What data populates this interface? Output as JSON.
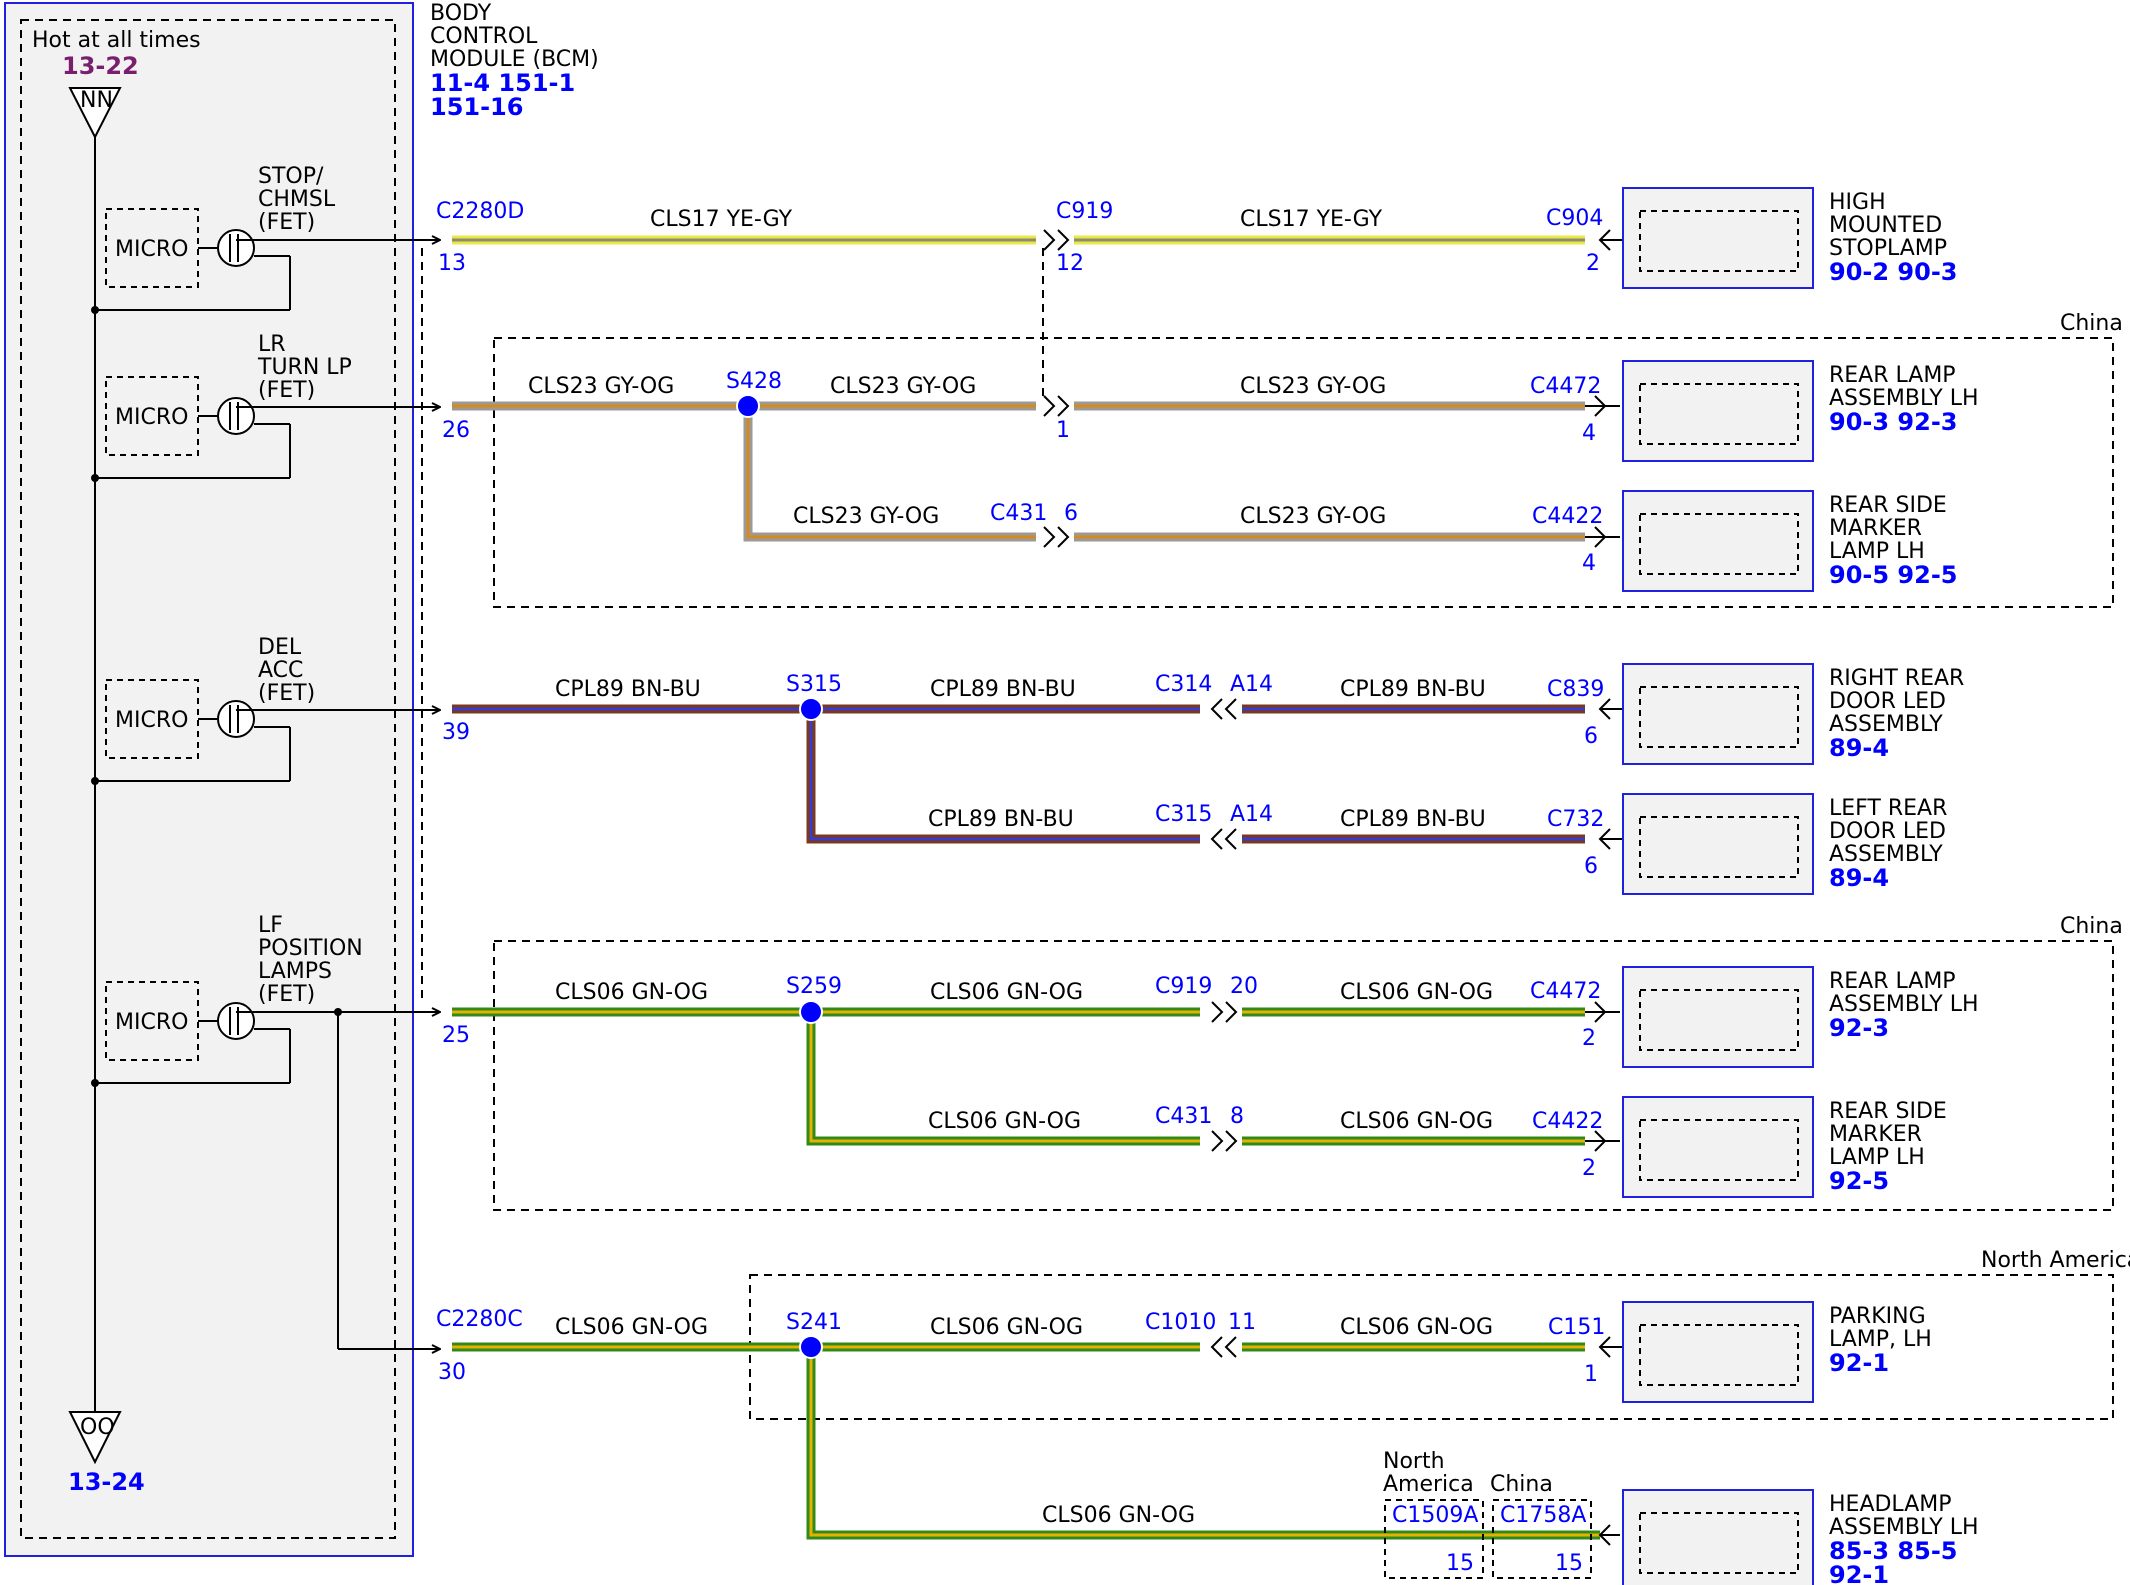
{
  "bcm": {
    "lines": [
      "BODY",
      "CONTROL",
      "MODULE (BCM)"
    ],
    "refs": [
      "11-4  151-1",
      "151-16"
    ],
    "hot_label": "Hot at all times",
    "top_ref": "13-22",
    "top_node": "NN",
    "bottom_ref": "13-24",
    "bottom_node": "OO",
    "micro": "MICRO",
    "outputs": [
      {
        "lines": [
          "STOP/",
          "CHMSL",
          "(FET)"
        ]
      },
      {
        "lines": [
          "LR",
          "TURN LP",
          "(FET)"
        ]
      },
      {
        "lines": [
          "DEL",
          "ACC",
          "(FET)"
        ]
      },
      {
        "lines": [
          "LF",
          "POSITION",
          "LAMPS",
          "(FET)"
        ]
      }
    ]
  },
  "regions": [
    "China",
    "China",
    "North America"
  ],
  "circuits": [
    "CLS17   YE-GY",
    "CLS23   GY-OG",
    "CPL89   BN-BU",
    "CLS06   GN-OG"
  ],
  "colors": {
    "ye_gy": [
      "#e8e84a",
      "#8c8c6e"
    ],
    "gy_og": [
      "#9a9a9a",
      "#d68a1e"
    ],
    "bn_bu": [
      "#7a3a1a",
      "#3a3ad0"
    ],
    "gn_og": [
      "#2f8a1a",
      "#e8b000"
    ]
  },
  "connectors": {
    "c2280d": "C2280D",
    "c2280d_pin13": "13",
    "c2280d_pin26": "26",
    "c2280d_pin39": "39",
    "c2280d_pin25": "25",
    "c2280c": "C2280C",
    "c2280c_pin30": "30",
    "c919": "C919",
    "c919_pin12": "12",
    "c919_pin1": "1",
    "c904": "C904",
    "c904_pin": "2",
    "s428": "S428",
    "s315": "S315",
    "s259": "S259",
    "s241": "S241",
    "c4472_a": "C4472",
    "c4472_a_pin": "4",
    "c431_6": "C431",
    "c431_6_pin": "6",
    "c4422_a": "C4422",
    "c4422_a_pin": "4",
    "c314": "C314",
    "c314_pin": "A14",
    "c839": "C839",
    "c839_pin": "6",
    "c315": "C315",
    "c315_pin": "A14",
    "c732": "C732",
    "c732_pin": "6",
    "c919_20": "C919",
    "c919_20_pin": "20",
    "c4472_b": "C4472",
    "c4472_b_pin": "2",
    "c431_8": "C431",
    "c431_8_pin": "8",
    "c4422_b": "C4422",
    "c4422_b_pin": "2",
    "c1010": "C1010",
    "c1010_pin": "11",
    "c151": "C151",
    "c151_pin": "1",
    "c1509a": "C1509A",
    "c1509a_pin": "15",
    "c1509a_region": [
      "North",
      "America"
    ],
    "c1758a": "C1758A",
    "c1758a_pin": "15",
    "c1758a_region": "China"
  },
  "components": [
    {
      "lines": [
        "HIGH",
        "MOUNTED",
        "STOPLAMP"
      ],
      "refs": "90-2   90-3"
    },
    {
      "lines": [
        "REAR LAMP",
        "ASSEMBLY LH"
      ],
      "refs": "90-3  92-3"
    },
    {
      "lines": [
        "REAR SIDE",
        "MARKER",
        "LAMP LH"
      ],
      "refs": "90-5  92-5"
    },
    {
      "lines": [
        "RIGHT REAR",
        "DOOR LED",
        "ASSEMBLY"
      ],
      "refs": "89-4"
    },
    {
      "lines": [
        "LEFT REAR",
        "DOOR LED",
        "ASSEMBLY"
      ],
      "refs": "89-4"
    },
    {
      "lines": [
        "REAR LAMP",
        "ASSEMBLY LH"
      ],
      "refs": "92-3"
    },
    {
      "lines": [
        "REAR SIDE",
        "MARKER",
        "LAMP LH"
      ],
      "refs": "92-5"
    },
    {
      "lines": [
        "PARKING",
        "LAMP, LH"
      ],
      "refs": "92-1"
    },
    {
      "lines": [
        "HEADLAMP",
        "ASSEMBLY LH"
      ],
      "refs": "85-3  85-5",
      "refs2": "92-1"
    }
  ]
}
